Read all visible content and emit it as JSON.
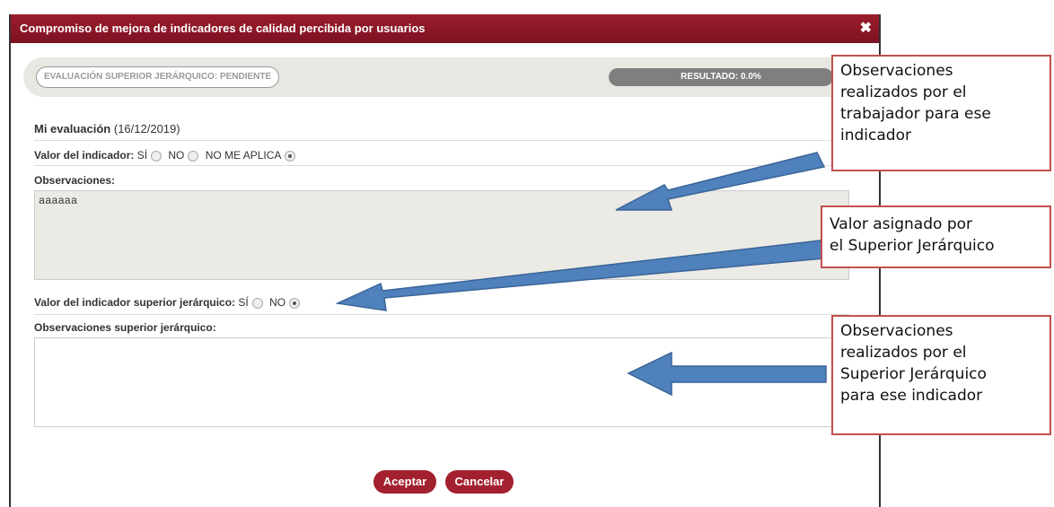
{
  "dialog": {
    "title": "Compromiso de mejora de indicadores de calidad percibida por usuarios",
    "close_glyph": "✖"
  },
  "status": {
    "evaluation_pill": "EVALUACIÓN SUPERIOR JERÁRQUICO: PENDIENTE",
    "result_pill": "RESULTADO: 0.0%"
  },
  "my_evaluation": {
    "title": "Mi evaluación",
    "date": "(16/12/2019)",
    "indicator_label": "Valor del indicador:",
    "options": [
      "SÍ",
      "NO",
      "NO ME APLICA"
    ],
    "selected_option": "NO ME APLICA",
    "observations_label": "Observaciones:",
    "observations_value": "aaaaaa"
  },
  "superior": {
    "indicator_label": "Valor del indicador superior jerárquico:",
    "options": [
      "SÍ",
      "NO"
    ],
    "selected_option": "NO",
    "observations_label": "Observaciones superior jerárquico:",
    "observations_value": ""
  },
  "buttons": {
    "accept": "Aceptar",
    "cancel": "Cancelar"
  },
  "callouts": {
    "worker_obs": [
      "Observaciones",
      "realizados por el",
      "trabajador para ese",
      "indicador"
    ],
    "superior_value": [
      "Valor asignado por",
      "el Superior Jerárquico"
    ],
    "superior_obs": [
      "Observaciones",
      "realizados por el",
      "Superior Jerárquico",
      "para ese indicador"
    ]
  },
  "colors": {
    "titlebar": "#8a1727",
    "button": "#a3202f",
    "callout_border": "#c0504d",
    "arrow": "#4f81bd"
  }
}
